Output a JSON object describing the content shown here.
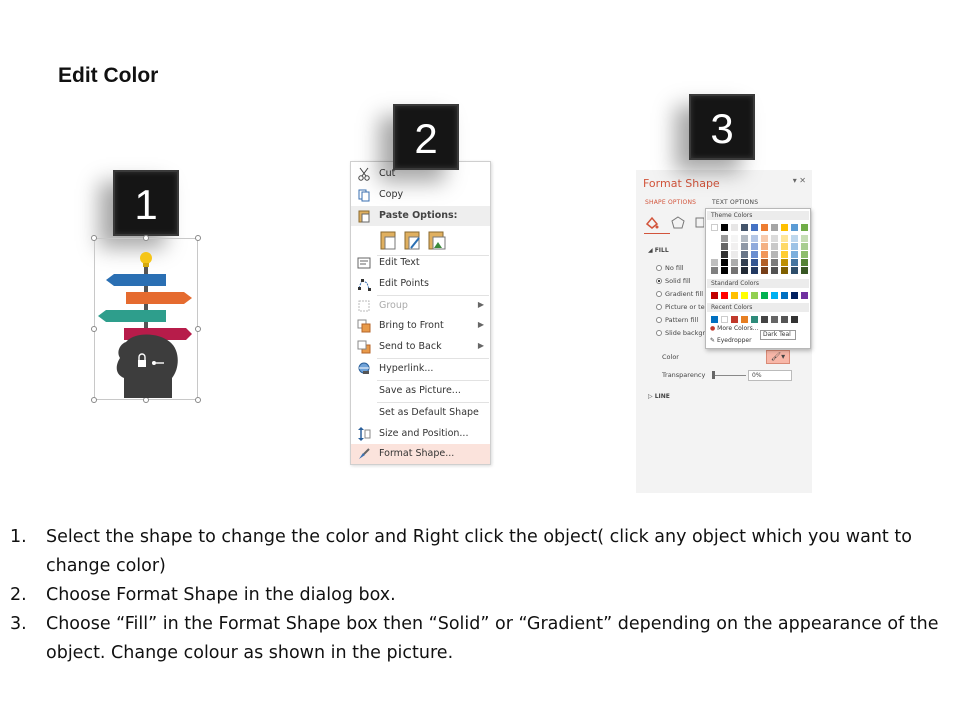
{
  "title": "Edit Color",
  "steps": [
    "1",
    "2",
    "3"
  ],
  "context_menu": {
    "items": [
      {
        "label": "Cut",
        "icon": "scissors-icon",
        "disabled": false
      },
      {
        "label": "Copy",
        "icon": "copy-icon",
        "disabled": false
      },
      {
        "label": "Paste Options:",
        "icon": "paste-icon",
        "disabled": false
      },
      {
        "label": "Edit Text",
        "icon": "edit-text-icon",
        "disabled": false
      },
      {
        "label": "Edit Points",
        "icon": "edit-points-icon",
        "disabled": false
      },
      {
        "label": "Group",
        "icon": "group-icon",
        "disabled": true
      },
      {
        "label": "Bring to Front",
        "icon": "bring-front-icon",
        "disabled": false
      },
      {
        "label": "Send to Back",
        "icon": "send-back-icon",
        "disabled": false
      },
      {
        "label": "Hyperlink...",
        "icon": "hyperlink-icon",
        "disabled": false
      },
      {
        "label": "Save as Picture...",
        "icon": "",
        "disabled": false
      },
      {
        "label": "Set as Default Shape",
        "icon": "",
        "disabled": false
      },
      {
        "label": "Size and Position...",
        "icon": "size-icon",
        "disabled": false
      },
      {
        "label": "Format Shape...",
        "icon": "format-shape-icon",
        "disabled": false
      }
    ]
  },
  "format_shape": {
    "title": "Format Shape",
    "tabs": [
      "SHAPE OPTIONS",
      "TEXT OPTIONS"
    ],
    "fill_section": "FILL",
    "fill_options": [
      "No fill",
      "Solid fill",
      "Gradient fill",
      "Picture or te",
      "Pattern fill",
      "Slide backgr"
    ],
    "selected_fill": "Solid fill",
    "color_label": "Color",
    "transparency_label": "Transparency",
    "transparency_value": "0%",
    "line_section": "LINE",
    "palette": {
      "theme_header": "Theme Colors",
      "standard_header": "Standard Colors",
      "recent_header": "Recent Colors",
      "more_colors": "More Colors...",
      "eyedropper": "Eyedropper",
      "tooltip": "Dark Teal",
      "theme_top": [
        "#ffffff",
        "#000000",
        "#e7e6e6",
        "#44546a",
        "#4472c4",
        "#ed7d31",
        "#a5a5a5",
        "#ffc000",
        "#5b9bd5",
        "#70ad47"
      ],
      "standard": [
        "#c00000",
        "#ff0000",
        "#ffc000",
        "#ffff00",
        "#92d050",
        "#00b050",
        "#00b0f0",
        "#0070c0",
        "#002060",
        "#7030a0"
      ],
      "recent": [
        "#0070c0",
        "#ffffff",
        "#c0392b",
        "#e67e22",
        "#2e8b7a",
        "#444444",
        "#666666",
        "#555555",
        "#333333"
      ]
    }
  },
  "instructions": [
    {
      "num": "1.",
      "text": "Select the shape to change the color and Right click the object( click any object which you want to change color)"
    },
    {
      "num": "2.",
      "text": "Choose Format Shape in the dialog box."
    },
    {
      "num": "3.",
      "text": "Choose “Fill” in the Format Shape box then “Solid” or “Gradient” depending on the appearance of the object. Change colour as shown in the picture."
    }
  ]
}
